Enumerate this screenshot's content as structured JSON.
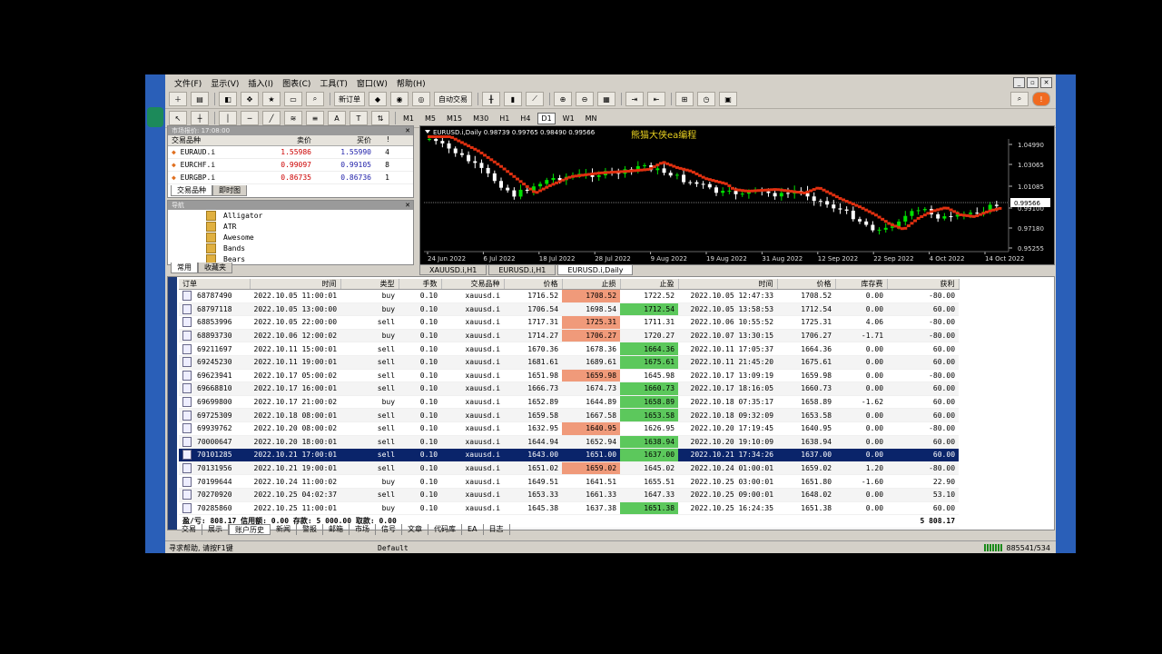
{
  "menu": [
    "文件(F)",
    "显示(V)",
    "插入(I)",
    "图表(C)",
    "工具(T)",
    "窗口(W)",
    "帮助(H)"
  ],
  "toolbar": {
    "new_order": "新订单",
    "auto_trade": "自动交易",
    "timeframes": [
      "M1",
      "M5",
      "M15",
      "M30",
      "H1",
      "H4",
      "D1",
      "W1",
      "MN"
    ],
    "active_tf": "D1"
  },
  "market_watch": {
    "title": "市场报价: 17:08:00",
    "headers": {
      "symbol": "交易品种",
      "bid": "卖价",
      "ask": "买价",
      "spread": "!"
    },
    "rows": [
      {
        "symbol": "EURAUD.i",
        "bid": "1.55986",
        "ask": "1.55990",
        "spread": "4"
      },
      {
        "symbol": "EURCHF.i",
        "bid": "0.99097",
        "ask": "0.99105",
        "spread": "8"
      },
      {
        "symbol": "EURGBP.i",
        "bid": "0.86735",
        "ask": "0.86736",
        "spread": "1"
      }
    ],
    "tabs": [
      "交易品种",
      "即时图"
    ]
  },
  "navigator": {
    "title": "导航",
    "items": [
      "Alligator",
      "ATR",
      "Awesome",
      "Bands",
      "Bears"
    ],
    "tabs": [
      "常用",
      "收藏夹"
    ]
  },
  "chart": {
    "header": "EURUSD.i,Daily  0.98739 0.99765 0.98490 0.99566",
    "watermark": "熊猫大侠ea编程",
    "price_label": "0.99566",
    "y_ticks": [
      "1.04990",
      "1.03065",
      "1.01085",
      "0.99100",
      "0.97180",
      "0.95255"
    ],
    "x_ticks": [
      "24 Jun 2022",
      "6 Jul 2022",
      "18 Jul 2022",
      "28 Jul 2022",
      "9 Aug 2022",
      "19 Aug 2022",
      "31 Aug 2022",
      "12 Sep 2022",
      "22 Sep 2022",
      "4 Oct 2022",
      "14 Oct 2022"
    ],
    "tabs": [
      "XAUUSD.i,H1",
      "EURUSD.i,H1",
      "EURUSD.i,Daily"
    ],
    "active_tab": "EURUSD.i,Daily",
    "colors": {
      "bull": "#00e000",
      "bear": "#ffffff",
      "ma": "#e03010"
    }
  },
  "terminal": {
    "headers": [
      "订单",
      "时间",
      "类型",
      "手数",
      "交易品种",
      "价格",
      "止损",
      "止盈",
      "时间",
      "价格",
      "库存费",
      "获利"
    ],
    "rows": [
      [
        "68787490",
        "2022.10.05 11:00:01",
        "buy",
        "0.10",
        "xauusd.i",
        "1716.52",
        "1708.52",
        "1722.52",
        "2022.10.05 12:47:33",
        "1708.52",
        "0.00",
        "-80.00",
        "sl"
      ],
      [
        "68797118",
        "2022.10.05 13:00:00",
        "buy",
        "0.10",
        "xauusd.i",
        "1706.54",
        "1698.54",
        "1712.54",
        "2022.10.05 13:58:53",
        "1712.54",
        "0.00",
        "60.00",
        "tp"
      ],
      [
        "68853996",
        "2022.10.05 22:00:00",
        "sell",
        "0.10",
        "xauusd.i",
        "1717.31",
        "1725.31",
        "1711.31",
        "2022.10.06 10:55:52",
        "1725.31",
        "4.06",
        "-80.00",
        "sl"
      ],
      [
        "68893730",
        "2022.10.06 12:00:02",
        "buy",
        "0.10",
        "xauusd.i",
        "1714.27",
        "1706.27",
        "1720.27",
        "2022.10.07 13:30:15",
        "1706.27",
        "-1.71",
        "-80.00",
        "sl"
      ],
      [
        "69211697",
        "2022.10.11 15:00:01",
        "sell",
        "0.10",
        "xauusd.i",
        "1670.36",
        "1678.36",
        "1664.36",
        "2022.10.11 17:05:37",
        "1664.36",
        "0.00",
        "60.00",
        "tp"
      ],
      [
        "69245230",
        "2022.10.11 19:00:01",
        "sell",
        "0.10",
        "xauusd.i",
        "1681.61",
        "1689.61",
        "1675.61",
        "2022.10.11 21:45:20",
        "1675.61",
        "0.00",
        "60.00",
        "tp"
      ],
      [
        "69623941",
        "2022.10.17 05:00:02",
        "sell",
        "0.10",
        "xauusd.i",
        "1651.98",
        "1659.98",
        "1645.98",
        "2022.10.17 13:09:19",
        "1659.98",
        "0.00",
        "-80.00",
        "sl"
      ],
      [
        "69668810",
        "2022.10.17 16:00:01",
        "sell",
        "0.10",
        "xauusd.i",
        "1666.73",
        "1674.73",
        "1660.73",
        "2022.10.17 18:16:05",
        "1660.73",
        "0.00",
        "60.00",
        "tp"
      ],
      [
        "69699800",
        "2022.10.17 21:00:02",
        "buy",
        "0.10",
        "xauusd.i",
        "1652.89",
        "1644.89",
        "1658.89",
        "2022.10.18 07:35:17",
        "1658.89",
        "-1.62",
        "60.00",
        "tp"
      ],
      [
        "69725309",
        "2022.10.18 08:00:01",
        "sell",
        "0.10",
        "xauusd.i",
        "1659.58",
        "1667.58",
        "1653.58",
        "2022.10.18 09:32:09",
        "1653.58",
        "0.00",
        "60.00",
        "tp"
      ],
      [
        "69939762",
        "2022.10.20 08:00:02",
        "sell",
        "0.10",
        "xauusd.i",
        "1632.95",
        "1640.95",
        "1626.95",
        "2022.10.20 17:19:45",
        "1640.95",
        "0.00",
        "-80.00",
        "sl"
      ],
      [
        "70000647",
        "2022.10.20 18:00:01",
        "sell",
        "0.10",
        "xauusd.i",
        "1644.94",
        "1652.94",
        "1638.94",
        "2022.10.20 19:10:09",
        "1638.94",
        "0.00",
        "60.00",
        "tp"
      ],
      [
        "70101285",
        "2022.10.21 17:00:01",
        "sell",
        "0.10",
        "xauusd.i",
        "1643.00",
        "1651.00",
        "1637.00",
        "2022.10.21 17:34:26",
        "1637.00",
        "0.00",
        "60.00",
        "tp"
      ],
      [
        "70131956",
        "2022.10.21 19:00:01",
        "sell",
        "0.10",
        "xauusd.i",
        "1651.02",
        "1659.02",
        "1645.02",
        "2022.10.24 01:00:01",
        "1659.02",
        "1.20",
        "-80.00",
        "sl"
      ],
      [
        "70199644",
        "2022.10.24 11:00:02",
        "buy",
        "0.10",
        "xauusd.i",
        "1649.51",
        "1641.51",
        "1655.51",
        "2022.10.25 03:00:01",
        "1651.80",
        "-1.60",
        "22.90",
        ""
      ],
      [
        "70270920",
        "2022.10.25 04:02:37",
        "sell",
        "0.10",
        "xauusd.i",
        "1653.33",
        "1661.33",
        "1647.33",
        "2022.10.25 09:00:01",
        "1648.02",
        "0.00",
        "53.10",
        ""
      ],
      [
        "70285860",
        "2022.10.25 11:00:01",
        "buy",
        "0.10",
        "xauusd.i",
        "1645.38",
        "1637.38",
        "1651.38",
        "2022.10.25 16:24:35",
        "1651.38",
        "0.00",
        "60.00",
        "tp"
      ]
    ],
    "selected_index": 12,
    "summary": "盈/亏: 808.17  信用额: 0.00  存款: 5 000.00  取款: 0.00",
    "summary_total": "5 808.17",
    "tabs": [
      "交易",
      "展示",
      "账户历史",
      "新闻",
      "警报",
      "邮箱",
      "市场",
      "信号",
      "文章",
      "代码库",
      "EA",
      "日志"
    ],
    "active_tab": "账户历史"
  },
  "status": {
    "help": "寻求帮助, 请按F1键",
    "profile": "Default",
    "connection": "885541/534"
  }
}
